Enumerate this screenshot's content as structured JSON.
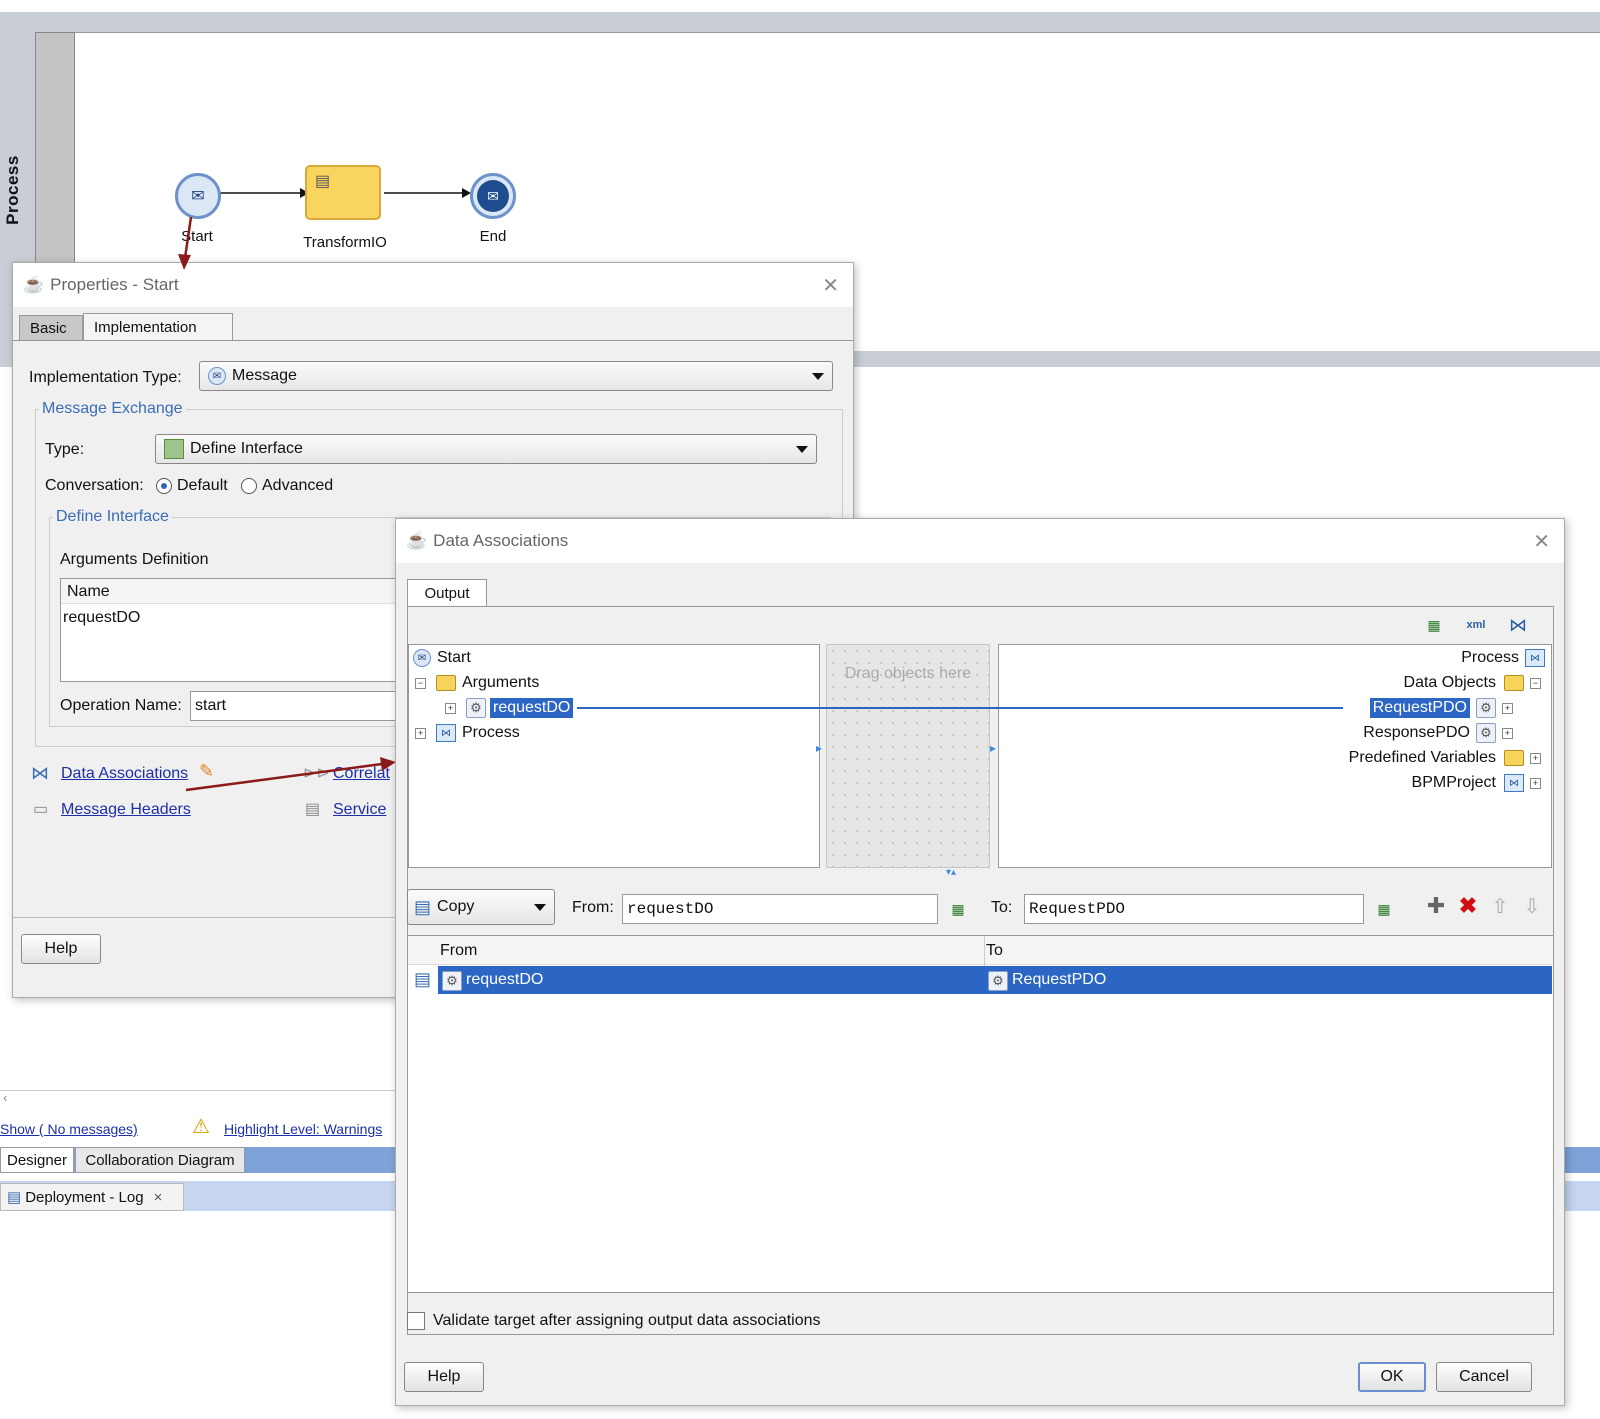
{
  "canvas": {
    "lane_title": "Process",
    "nodes": {
      "start_label": "Start",
      "task_label": "TransformIO",
      "end_label": "End"
    }
  },
  "properties_dialog": {
    "title": "Properties - Start",
    "close_glyph": "✕",
    "tabs": [
      "Basic",
      "Implementation"
    ],
    "implementation_type_label": "Implementation Type:",
    "implementation_type_value": "Message",
    "message_exchange_legend": "Message Exchange",
    "type_label": "Type:",
    "type_value": "Define Interface",
    "conversation_label": "Conversation:",
    "conversation_options": [
      "Default",
      "Advanced"
    ],
    "define_interface_legend": "Define Interface",
    "arguments_definition_label": "Arguments Definition",
    "arguments_table_header": "Name",
    "arguments_rows": [
      "requestDO"
    ],
    "operation_name_label": "Operation Name:",
    "operation_name_value": "start",
    "links": {
      "data_associations": "Data Associations",
      "correlations": "Correlat",
      "message_headers": "Message Headers",
      "service": "Service"
    },
    "help_button": "Help"
  },
  "background_status": {
    "show_messages": "Show ( No messages)",
    "highlight_level": "Highlight Level: Warnings",
    "tabs": [
      "Designer",
      "Collaboration Diagram"
    ],
    "log_tab": "Deployment - Log",
    "log_close": "×"
  },
  "data_associations_dialog": {
    "title": "Data Associations",
    "close_glyph": "✕",
    "tab": "Output",
    "source_tree": {
      "root": "Start",
      "arguments": "Arguments",
      "argument_item": "requestDO",
      "process": "Process"
    },
    "drop_zone": "Drag objects here",
    "target_tree": {
      "process": "Process",
      "data_objects": "Data Objects",
      "request_pdo": "RequestPDO",
      "response_pdo": "ResponsePDO",
      "predefined_variables": "Predefined Variables",
      "bpm_project": "BPMProject"
    },
    "operation_value": "Copy",
    "from_label": "From:",
    "from_value": "requestDO",
    "to_label": "To:",
    "to_value": "RequestPDO",
    "table_headers": [
      "From",
      "To"
    ],
    "table_rows": [
      {
        "from": "requestDO",
        "to": "RequestPDO"
      }
    ],
    "validate_checkbox_label": "Validate target after assigning output data associations",
    "help_button": "Help",
    "ok_button": "OK",
    "cancel_button": "Cancel"
  },
  "colors": {
    "selection": "#2c66c5",
    "link": "#1c2fa8",
    "legend": "#3a6db5",
    "task_fill": "#f9d560",
    "annotation_arrow": "#8b1a1a"
  }
}
